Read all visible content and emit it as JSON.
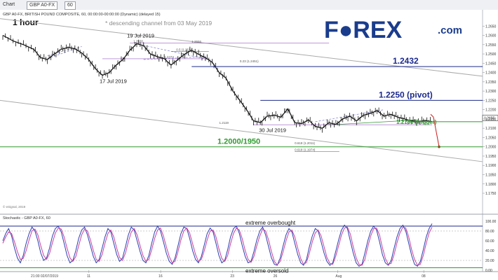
{
  "toolbar": {
    "tab": "Chart",
    "symbol": "GBP A0-FX",
    "interval": "60"
  },
  "main_panel": {
    "header": "GBP A0-FX, BRITISH POUND COMPOSITE, 60, 00:00:00-00:00:00 (Dynamic) (delayed 15)",
    "timeframe": "1 hour",
    "note": "* descending channel from 03 May 2019",
    "logo": {
      "text": "F●REX",
      "suffix": ".com",
      "color": "#1a3c8c"
    },
    "copyright": "© eSignal, 2019"
  },
  "stoch_panel": {
    "header": "Stochastic - GBP A0-FX, 60"
  },
  "chart_data": [
    {
      "type": "line",
      "panel": "price",
      "y_axis_ticks": [
        "1.2650",
        "1.2600",
        "1.2550",
        "1.2500",
        "1.2450",
        "1.2400",
        "1.2350",
        "1.2300",
        "1.2250",
        "1.2200",
        "1.2150",
        "1.2100",
        "1.2050",
        "1.2000",
        "1.1950",
        "1.1900",
        "1.1850",
        "1.1800",
        "1.1750"
      ],
      "x_axis_ticks": [
        "11",
        "16",
        "23",
        "26",
        "Aug",
        "08"
      ],
      "x_axis_first_label": "21:00 02/07/2019",
      "ylim": [
        1.172,
        1.27
      ],
      "price_path": [
        [
          0,
          1.26
        ],
        [
          6,
          1.257
        ],
        [
          12,
          1.255
        ],
        [
          18,
          1.2525
        ],
        [
          22,
          1.248
        ],
        [
          26,
          1.247
        ],
        [
          30,
          1.25
        ],
        [
          34,
          1.2525
        ],
        [
          38,
          1.2535
        ],
        [
          42,
          1.2528
        ],
        [
          46,
          1.2505
        ],
        [
          50,
          1.247
        ],
        [
          54,
          1.242
        ],
        [
          58,
          1.2385
        ],
        [
          62,
          1.24
        ],
        [
          66,
          1.244
        ],
        [
          70,
          1.247
        ],
        [
          74,
          1.252
        ],
        [
          78,
          1.2555
        ],
        [
          82,
          1.2545
        ],
        [
          86,
          1.25
        ],
        [
          90,
          1.2485
        ],
        [
          94,
          1.2475
        ],
        [
          98,
          1.244
        ],
        [
          102,
          1.247
        ],
        [
          106,
          1.25
        ],
        [
          110,
          1.252
        ],
        [
          114,
          1.2498
        ],
        [
          118,
          1.248
        ],
        [
          122,
          1.2455
        ],
        [
          126,
          1.24
        ],
        [
          130,
          1.237
        ],
        [
          134,
          1.23
        ],
        [
          138,
          1.225
        ],
        [
          142,
          1.22
        ],
        [
          146,
          1.214
        ],
        [
          150,
          1.213
        ],
        [
          154,
          1.2165
        ],
        [
          158,
          1.217
        ],
        [
          162,
          1.216
        ],
        [
          166,
          1.2205
        ],
        [
          170,
          1.213
        ],
        [
          174,
          1.2125
        ],
        [
          178,
          1.2145
        ],
        [
          182,
          1.211
        ],
        [
          186,
          1.21
        ],
        [
          190,
          1.213
        ],
        [
          194,
          1.212
        ],
        [
          198,
          1.215
        ],
        [
          202,
          1.2165
        ],
        [
          206,
          1.214
        ],
        [
          210,
          1.217
        ],
        [
          214,
          1.218
        ],
        [
          218,
          1.2195
        ],
        [
          222,
          1.2165
        ],
        [
          226,
          1.2175
        ],
        [
          230,
          1.216
        ],
        [
          234,
          1.215
        ],
        [
          238,
          1.214
        ],
        [
          242,
          1.2135
        ],
        [
          246,
          1.2142
        ],
        [
          250,
          1.2135
        ]
      ],
      "last_price": "1.2155",
      "horizontal_levels": [
        {
          "value": 1.2432,
          "label": "1.2432",
          "color": "#1c2a8c"
        },
        {
          "value": 1.225,
          "label": "1.2250 (pivot)",
          "color": "#1c2a8c"
        },
        {
          "value": 1.2135,
          "label": "1.2135 (trigger)",
          "color": "#2e9a2e"
        },
        {
          "value": 1.2,
          "label": "1.2000/1950",
          "color": "#2e9a2e"
        }
      ],
      "small_labels": [
        {
          "text": "1.2558",
          "value": 1.2558
        },
        {
          "text": "1.2556",
          "value": 1.2556
        },
        {
          "text": "0.5 (1.2514)",
          "value": 1.2514
        },
        {
          "text": "1.2474",
          "value": 1.2474
        },
        {
          "text": "0.23 (1.2451)",
          "value": 1.2451
        },
        {
          "text": "1.2119",
          "value": 1.2119
        },
        {
          "text": "0.618 (1.2011)",
          "value": 1.2011
        },
        {
          "text": "0.618 (1.1974)",
          "value": 1.1974
        }
      ],
      "date_annotations": [
        "19 Jul 2019",
        "17 Jul 2019",
        "30 Jul 2019"
      ],
      "projection": {
        "from": 1.216,
        "to": 1.2,
        "color": "#cc1a1a"
      }
    },
    {
      "type": "line",
      "panel": "stochastic",
      "ylim": [
        0,
        100
      ],
      "y_axis_ticks": [
        "100.00",
        "80.00",
        "60.00",
        "40.00",
        "20.00",
        "0.00"
      ],
      "levels": [
        {
          "value": 90,
          "label": "extreme overbought",
          "color": "#1c2a8c"
        },
        {
          "value": 80,
          "label": "",
          "color": "#999999"
        },
        {
          "value": 20,
          "label": "",
          "color": "#999999"
        },
        {
          "value": 5,
          "label": "extreme oversold",
          "color": "#2e9a2e"
        }
      ],
      "series": [
        {
          "color": "#2a3fb0",
          "values": [
            60,
            75,
            85,
            70,
            45,
            25,
            15,
            30,
            55,
            75,
            88,
            80,
            60,
            35,
            20,
            25,
            45,
            70,
            85,
            90,
            78,
            55,
            30,
            15,
            20,
            40,
            65,
            82,
            88,
            72,
            50,
            28,
            15,
            22,
            45,
            68,
            85,
            78,
            55,
            32,
            18,
            25,
            48,
            72,
            88,
            82,
            60,
            38,
            20,
            15,
            30,
            55,
            78,
            90,
            80,
            58,
            35,
            18,
            12,
            25,
            50,
            75,
            88,
            85,
            65,
            40,
            22,
            15,
            28,
            52,
            75,
            86,
            78,
            55,
            30,
            15,
            20,
            42,
            68,
            85,
            90,
            75,
            50,
            28,
            15,
            18,
            38,
            62,
            80,
            88,
            72,
            48,
            25,
            12,
            10,
            25,
            50,
            72,
            85,
            78,
            55,
            32,
            15,
            10,
            22,
            48,
            70,
            85,
            80,
            58,
            35,
            18,
            10,
            15,
            38,
            62,
            82,
            92,
            85,
            60,
            35,
            15,
            8,
            12,
            35,
            60,
            80,
            90,
            82,
            58,
            32,
            15,
            10,
            20,
            45,
            68,
            85,
            92,
            80,
            55,
            30,
            12,
            8,
            18,
            42,
            68,
            85,
            95
          ]
        },
        {
          "color": "#cc3fa0",
          "values": [
            55,
            68,
            78,
            75,
            58,
            38,
            22,
            24,
            40,
            62,
            80,
            84,
            72,
            50,
            30,
            22,
            34,
            56,
            76,
            86,
            84,
            68,
            45,
            25,
            18,
            28,
            50,
            72,
            84,
            80,
            62,
            40,
            22,
            18,
            32,
            55,
            75,
            82,
            68,
            45,
            26,
            20,
            35,
            58,
            78,
            85,
            72,
            50,
            30,
            18,
            22,
            42,
            65,
            82,
            86,
            70,
            48,
            28,
            15,
            18,
            38,
            62,
            80,
            86,
            76,
            54,
            32,
            18,
            22,
            40,
            62,
            80,
            82,
            68,
            44,
            24,
            18,
            30,
            54,
            75,
            86,
            82,
            64,
            40,
            22,
            16,
            28,
            50,
            70,
            84,
            80,
            62,
            38,
            18,
            11,
            18,
            38,
            60,
            78,
            82,
            68,
            45,
            24,
            12,
            16,
            35,
            58,
            76,
            82,
            70,
            48,
            26,
            14,
            12,
            28,
            50,
            72,
            86,
            88,
            74,
            48,
            25,
            12,
            10,
            22,
            48,
            70,
            85,
            86,
            72,
            46,
            24,
            12,
            14,
            32,
            56,
            76,
            88,
            86,
            68,
            42,
            22,
            10,
            12,
            30,
            55,
            76,
            88
          ]
        }
      ]
    }
  ]
}
